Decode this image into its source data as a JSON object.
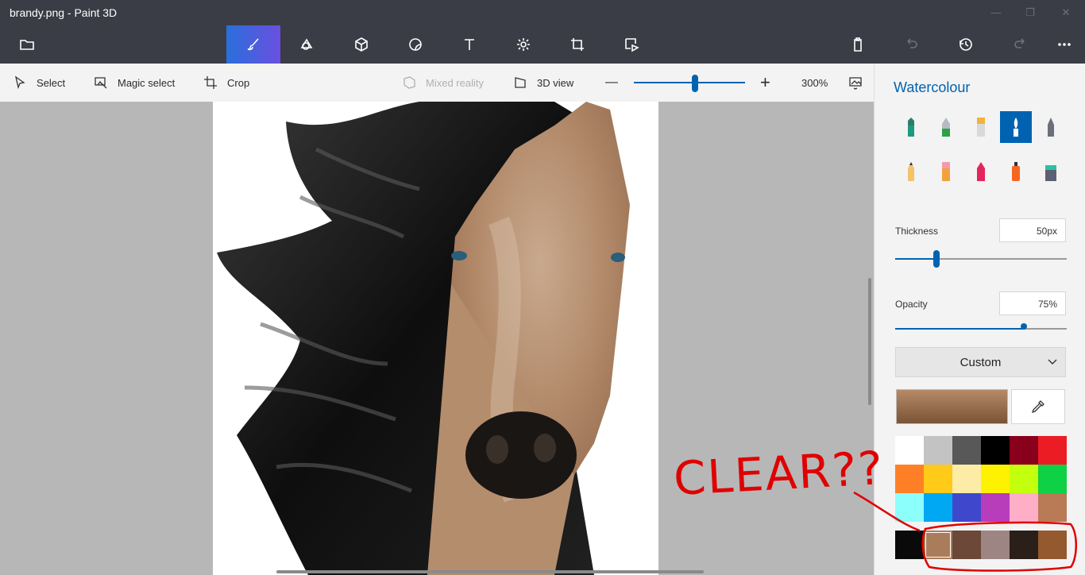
{
  "window": {
    "title": "brandy.png - Paint 3D",
    "minimize_glyph": "—",
    "maximize_glyph": "❐",
    "close_glyph": "✕"
  },
  "ribbon": {
    "tools": [
      {
        "name": "menu-icon"
      },
      {
        "name": "brushes-icon",
        "active": true
      },
      {
        "name": "2d-shapes-icon"
      },
      {
        "name": "3d-shapes-icon"
      },
      {
        "name": "stickers-icon"
      },
      {
        "name": "text-icon"
      },
      {
        "name": "effects-icon"
      },
      {
        "name": "canvas-icon"
      },
      {
        "name": "3d-library-icon"
      }
    ],
    "right": [
      "paste-icon",
      "undo-icon",
      "history-icon",
      "redo-icon",
      "more-icon"
    ]
  },
  "toolbar": {
    "select": "Select",
    "magic_select": "Magic select",
    "crop": "Crop",
    "mixed_reality": "Mixed reality",
    "view_3d": "3D view",
    "zoom_out": "—",
    "zoom_in": "+",
    "zoom_level": "300%",
    "zoom_fraction": 0.55
  },
  "panel": {
    "title": "Watercolour",
    "brushes": [
      "marker-icon",
      "calligraphy-pen-icon",
      "oil-brush-icon",
      "watercolour-icon",
      "pixel-pen-icon",
      "pencil-icon",
      "eraser-icon",
      "crayon-icon",
      "spray-can-icon",
      "fill-icon"
    ],
    "selected_brush": "watercolour-icon",
    "thickness_label": "Thickness",
    "thickness_value": "50px",
    "thickness_fraction": 0.24,
    "opacity_label": "Opacity",
    "opacity_value": "75%",
    "opacity_fraction": 0.75,
    "color_mode": "Custom",
    "current_color": "#b58a68",
    "palette_rows": [
      [
        "#ffffff",
        "#c3c3c3",
        "#585858",
        "#000000",
        "#88001b",
        "#ec1c24"
      ],
      [
        "#ff7f27",
        "#ffca18",
        "#fdeca6",
        "#fff200",
        "#c4ff0e",
        "#0ed145"
      ],
      [
        "#8cfffb",
        "#00a8f3",
        "#3f48cc",
        "#b83dba",
        "#ffaec8",
        "#b97a56"
      ]
    ],
    "custom_colors": [
      "#0a0a0a",
      "#a97d5c",
      "#6b4837",
      "#9c8583",
      "#2b1f19",
      "#94592f"
    ]
  },
  "annotation": {
    "text": "CLEAR??",
    "color": "#e00000"
  }
}
